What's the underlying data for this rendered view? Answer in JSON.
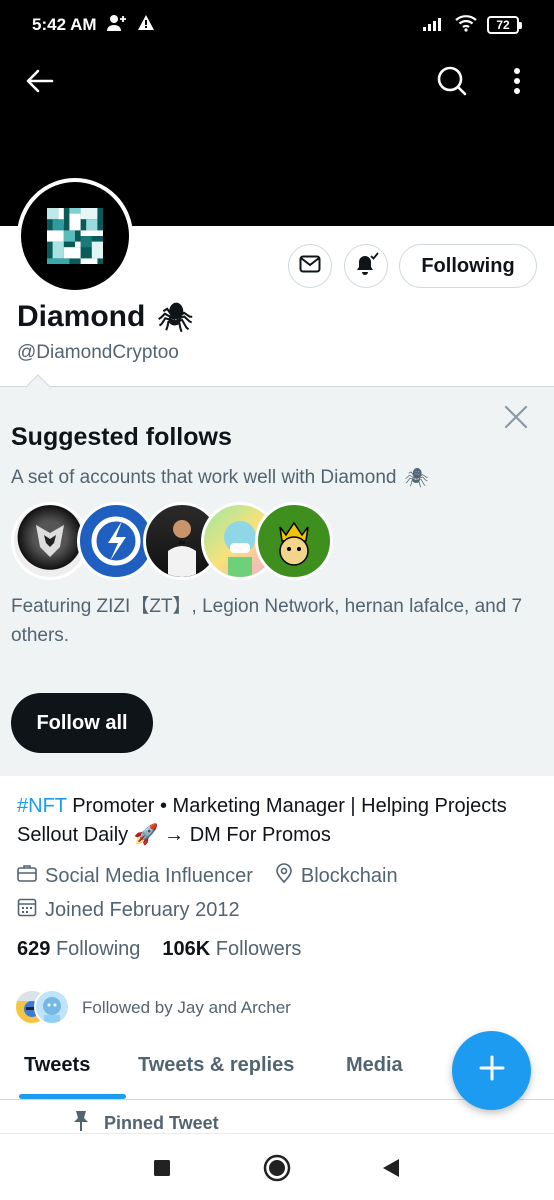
{
  "status_bar": {
    "time": "5:42 AM",
    "battery": "72"
  },
  "header": {
    "icons": [
      "back-arrow-icon",
      "search-icon",
      "more-vertical-icon"
    ]
  },
  "profile": {
    "display_name": "Diamond",
    "name_emoji": "🕷",
    "handle": "@DiamondCryptoo",
    "following_button_label": "Following",
    "action_icons": [
      "mail-icon",
      "bell-subscribed-icon"
    ]
  },
  "suggested_follows": {
    "title": "Suggested follows",
    "subtitle": "A set of accounts that work well with Diamond",
    "subtitle_emoji": "🕷",
    "featuring": "Featuring ZIZI【ZT】, Legion Network, hernan lafalce, and 7 others.",
    "follow_all_label": "Follow all",
    "avatars": [
      "zizi-avatar",
      "legion-network-avatar",
      "hernan-lafalce-avatar",
      "cartoon-avatar",
      "king-avatar"
    ]
  },
  "bio": {
    "hashtag": "#NFT",
    "text": " Promoter • Marketing Manager | Helping Projects Sellout Daily 🚀 → DM For Promos"
  },
  "meta": {
    "category": "Social Media Influencer",
    "location": "Blockchain",
    "joined": "Joined February 2012"
  },
  "stats": {
    "following_count": "629",
    "following_label": "Following",
    "followers_count": "106K",
    "followers_label": "Followers"
  },
  "followed_by": {
    "text": "Followed by Jay and Archer"
  },
  "tabs": [
    {
      "label": "Tweets",
      "active": true
    },
    {
      "label": "Tweets & replies",
      "active": false
    },
    {
      "label": "Media",
      "active": false
    }
  ],
  "pinned": {
    "label": "Pinned Tweet"
  },
  "colors": {
    "accent": "#1d9bf0",
    "text_primary": "#0f1419",
    "text_secondary": "#536471",
    "suggested_bg": "#eff3f4"
  }
}
